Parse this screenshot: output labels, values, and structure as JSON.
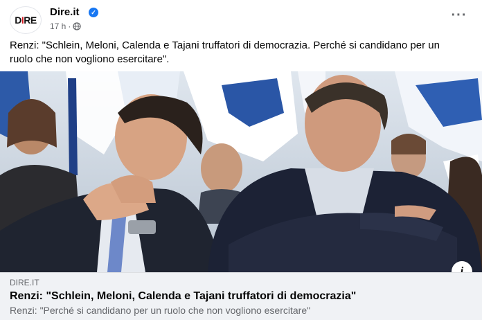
{
  "post": {
    "page_name": "Dire.it",
    "verified_icon": "verified-badge-icon",
    "timestamp": "17 h",
    "separator": "·",
    "audience_icon": "globe-icon",
    "more_icon": "more-horizontal-icon",
    "more_label": "···",
    "text": "Renzi: \"Schlein, Meloni, Calenda e Tajani truffatori di democrazia. Perché si candidano per un ruolo che non vogliono esercitare\"."
  },
  "avatar": {
    "logo_prefix": "D",
    "logo_accent": "I",
    "logo_suffix": "RE",
    "accent_color": "#d71920"
  },
  "link_preview": {
    "domain": "DIRE.IT",
    "title": "Renzi: \"Schlein, Meloni, Calenda e Tajani truffatori di democrazia\"",
    "description": "Renzi: \"Perché si candidano per un ruolo che non vogliono esercitare\"",
    "info_icon": "info-icon",
    "info_label": "i"
  },
  "colors": {
    "brand_blue": "#1877f2",
    "secondary_text": "#65676b",
    "card_background": "#f0f2f5"
  }
}
